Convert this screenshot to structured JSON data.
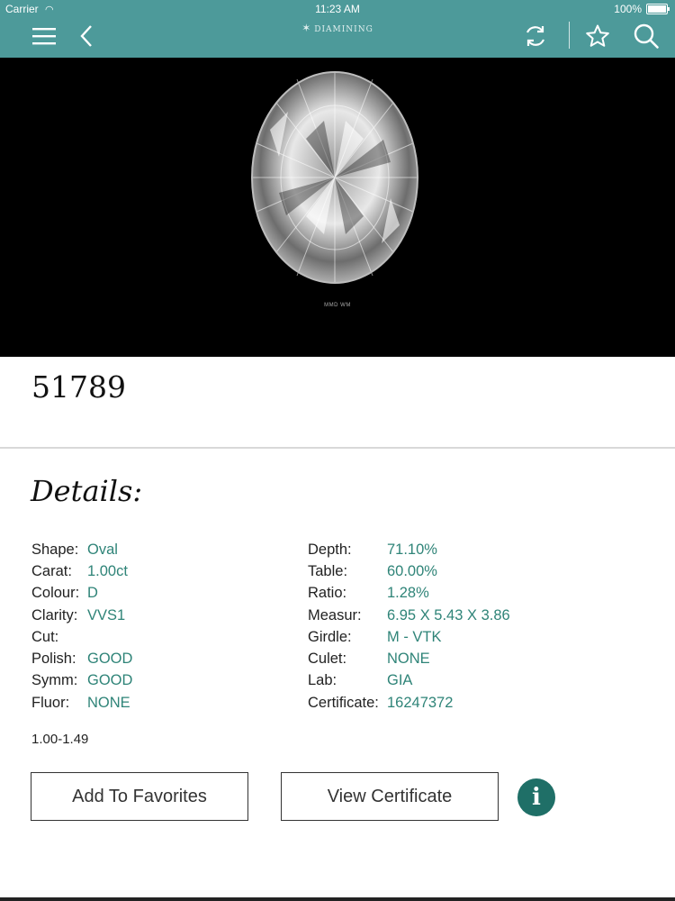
{
  "status_bar": {
    "carrier": "Carrier",
    "time": "11:23 AM",
    "battery": "100%"
  },
  "nav": {
    "brand": "DIAMINING",
    "icons": [
      "menu-icon",
      "back-chevron-icon",
      "refresh-icon",
      "star-icon",
      "search-icon"
    ]
  },
  "hero": {
    "caption": "MMD WM"
  },
  "stock_id": "51789",
  "details_heading": "Details:",
  "specs_left": [
    {
      "label": "Shape:",
      "value": "Oval"
    },
    {
      "label": "Carat:",
      "value": "1.00ct"
    },
    {
      "label": "Colour:",
      "value": "D"
    },
    {
      "label": "Clarity:",
      "value": "VVS1"
    },
    {
      "label": "Cut:",
      "value": ""
    },
    {
      "label": "Polish:",
      "value": "GOOD"
    },
    {
      "label": "Symm:",
      "value": "GOOD"
    },
    {
      "label": "Fluor:",
      "value": "NONE"
    }
  ],
  "specs_right": [
    {
      "label": "Depth:",
      "value": "71.10%"
    },
    {
      "label": "Table:",
      "value": "60.00%"
    },
    {
      "label": "Ratio:",
      "value": "1.28%"
    },
    {
      "label": "Measur:",
      "value": "6.95 X 5.43 X 3.86"
    },
    {
      "label": "Girdle:",
      "value": "M - VTK"
    },
    {
      "label": "Culet:",
      "value": "NONE"
    },
    {
      "label": "Lab:",
      "value": "GIA"
    },
    {
      "label": "Certificate:",
      "value": "16247372"
    }
  ],
  "range": "1.00-1.49",
  "buttons": {
    "favorites": "Add To Favorites",
    "certificate": "View Certificate",
    "info_glyph": "i"
  },
  "colors": {
    "header": "#4d9a9a",
    "value_text": "#2f8478",
    "info_button": "#1f6f67"
  }
}
